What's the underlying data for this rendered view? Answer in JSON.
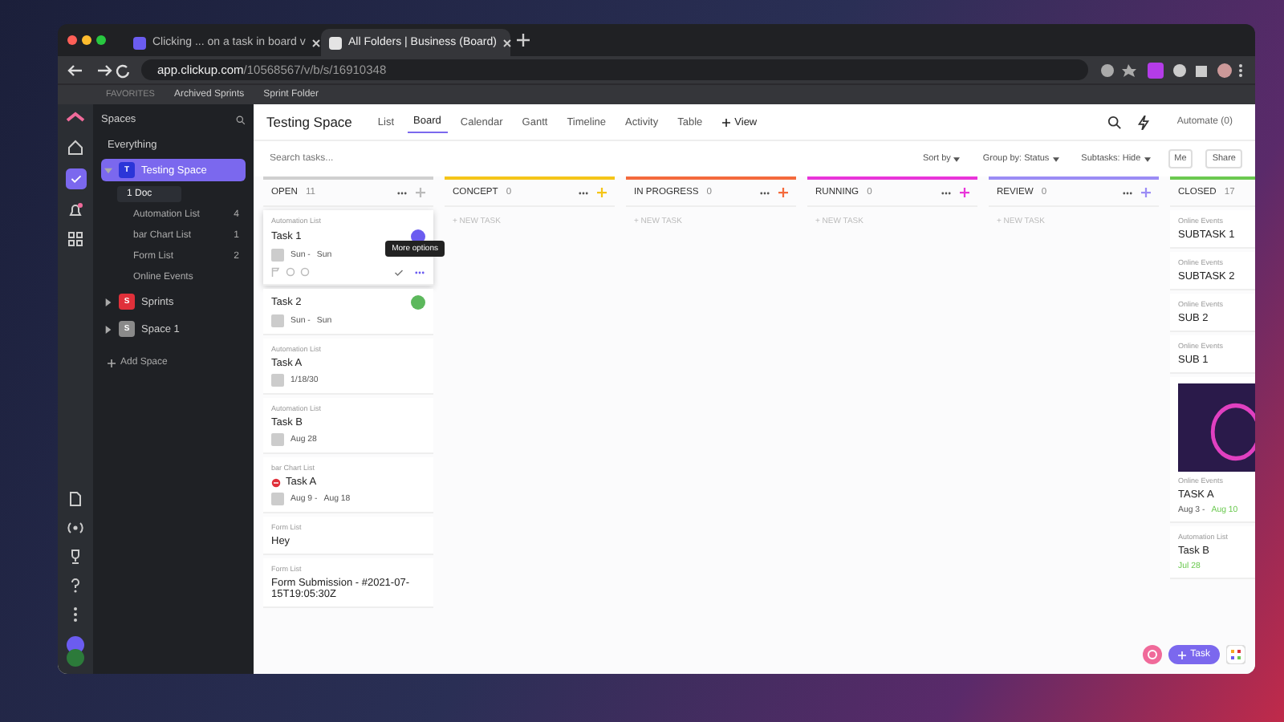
{
  "browser": {
    "tabs": [
      {
        "title": "Clicking ... on a task in board v",
        "selected": false
      },
      {
        "title": "All Folders | Business (Board)",
        "selected": true
      }
    ],
    "url_host": "app.clickup.com",
    "url_path": "/10568567/v/b/s/16910348"
  },
  "bookmarks": {
    "label": "FAVORITES",
    "items": [
      "Archived Sprints",
      "Sprint Folder"
    ]
  },
  "sidebar": {
    "title": "Spaces",
    "everything": "Everything",
    "spaces": [
      {
        "name": "Testing Space",
        "letter": "T",
        "color": "#2b35d8",
        "selected": true,
        "expanded": true,
        "children": [
          {
            "name": "1 Doc",
            "kind": "doc",
            "selected": true
          },
          {
            "name": "Automation List",
            "kind": "list",
            "count": "4",
            "selected": false
          },
          {
            "name": "bar Chart List",
            "kind": "list",
            "count": "1",
            "selected": false
          },
          {
            "name": "Form List",
            "kind": "list",
            "count": "2",
            "selected": false
          },
          {
            "name": "Online Events",
            "kind": "list",
            "selected": false
          }
        ]
      },
      {
        "name": "Sprints",
        "letter": "S",
        "color": "#e0303a",
        "selected": false,
        "expanded": false
      },
      {
        "name": "Space 1",
        "letter": "S",
        "color": "#8a8a8a",
        "selected": false,
        "expanded": false
      }
    ],
    "add_space": "Add Space"
  },
  "header": {
    "title": "Testing Space",
    "views": [
      {
        "label": "List",
        "selected": false
      },
      {
        "label": "Board",
        "selected": true
      },
      {
        "label": "Calendar",
        "selected": false
      },
      {
        "label": "Gantt",
        "selected": false
      },
      {
        "label": "Timeline",
        "selected": false
      },
      {
        "label": "Activity",
        "selected": false
      },
      {
        "label": "Table",
        "selected": false
      }
    ],
    "add_view": "View",
    "automate": "Automate (0)"
  },
  "toolbar": {
    "search": {
      "placeholder": "Search tasks..."
    },
    "sort": "Sort by",
    "group": "Group by: Status",
    "subtasks": "Subtasks: Hide",
    "me": "Me",
    "share": "Share"
  },
  "columns": [
    {
      "name": "OPEN",
      "count": "11",
      "color": "#d0d0d0",
      "cards": [
        {
          "list": "Automation List",
          "title": "Task 1",
          "start": "Sun -",
          "due": "Sun",
          "color": "#6b5cf0",
          "hovered": true
        },
        {
          "title": "Task 2",
          "start": "Sun -",
          "due": "Sun",
          "color": "#5cb85c"
        },
        {
          "list": "Automation List",
          "title": "Task A",
          "due": "1/18/30"
        },
        {
          "list": "Automation List",
          "title": "Task B",
          "due": "Aug 28"
        },
        {
          "list": "bar Chart List",
          "title": "Task A",
          "start": "Aug 9 -",
          "plain_due": "Aug 18",
          "warning": true
        },
        {
          "list": "Form List",
          "title": "Hey"
        },
        {
          "list": "Form List",
          "title": "Form Submission - #2021-07-15T19:05:30Z"
        }
      ]
    },
    {
      "name": "CONCEPT",
      "count": "0",
      "color": "#f5c518",
      "new_task": "+ NEW TASK"
    },
    {
      "name": "IN PROGRESS",
      "count": "0",
      "color": "#f46a3c",
      "new_task": "+ NEW TASK"
    },
    {
      "name": "RUNNING",
      "count": "0",
      "color": "#e935d9",
      "new_task": "+ NEW TASK"
    },
    {
      "name": "REVIEW",
      "count": "0",
      "color": "#9b8cf5",
      "new_task": "+ NEW TASK"
    },
    {
      "name": "CLOSED",
      "count": "17",
      "color": "#6bc950",
      "cards": [
        {
          "list": "Online Events",
          "title": "SUBTASK 1"
        },
        {
          "list": "Online Events",
          "title": "SUBTASK 2"
        },
        {
          "list": "Online Events",
          "title": "SUB 2"
        },
        {
          "list": "Online Events",
          "title": "SUB 1"
        },
        {
          "image": true,
          "list": "Online Events",
          "title": "TASK A",
          "start": "Aug 3 -",
          "done_due": "Aug 10"
        },
        {
          "list": "Automation List",
          "title": "Task B",
          "done_due": "Jul 28"
        }
      ]
    }
  ],
  "tooltip": "More options",
  "fab": {
    "label": "Task"
  }
}
